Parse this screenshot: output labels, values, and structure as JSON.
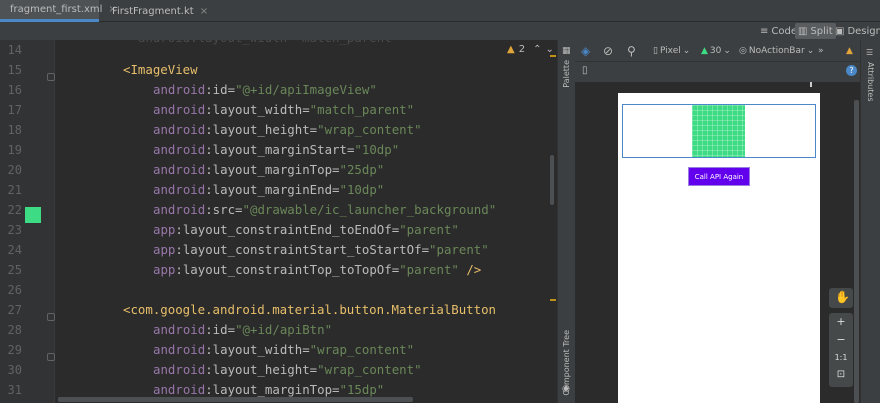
{
  "tabs": [
    {
      "label": "fragment_first.xml",
      "icon": "xml-file-icon",
      "active": true
    },
    {
      "label": "FirstFragment.kt",
      "icon": "kotlin-file-icon",
      "active": false
    }
  ],
  "view_modes": {
    "code": "Code",
    "split": "Split",
    "design": "Design"
  },
  "editor": {
    "warning_count": "2",
    "lines": [
      {
        "n": "14",
        "parts": []
      },
      {
        "n": "15",
        "parts": [
          {
            "c": "punc",
            "t": "<"
          },
          {
            "c": "tag",
            "t": "ImageView"
          }
        ]
      },
      {
        "n": "16",
        "parts": [
          {
            "c": "ns",
            "t": "android"
          },
          {
            "c": "attr",
            "t": ":id="
          },
          {
            "c": "val",
            "t": "\"@+id/apiImageView\""
          }
        ]
      },
      {
        "n": "17",
        "parts": [
          {
            "c": "ns",
            "t": "android"
          },
          {
            "c": "attr",
            "t": ":layout_width="
          },
          {
            "c": "val",
            "t": "\"match_parent\""
          }
        ]
      },
      {
        "n": "18",
        "parts": [
          {
            "c": "ns",
            "t": "android"
          },
          {
            "c": "attr",
            "t": ":layout_height="
          },
          {
            "c": "val",
            "t": "\"wrap_content\""
          }
        ]
      },
      {
        "n": "19",
        "parts": [
          {
            "c": "ns",
            "t": "android"
          },
          {
            "c": "attr",
            "t": ":layout_marginStart="
          },
          {
            "c": "val",
            "t": "\"10dp\""
          }
        ]
      },
      {
        "n": "20",
        "parts": [
          {
            "c": "ns",
            "t": "android"
          },
          {
            "c": "attr",
            "t": ":layout_marginTop="
          },
          {
            "c": "val",
            "t": "\"25dp\""
          }
        ]
      },
      {
        "n": "21",
        "parts": [
          {
            "c": "ns",
            "t": "android"
          },
          {
            "c": "attr",
            "t": ":layout_marginEnd="
          },
          {
            "c": "val",
            "t": "\"10dp\""
          }
        ]
      },
      {
        "n": "22",
        "parts": [
          {
            "c": "ns",
            "t": "android"
          },
          {
            "c": "attr",
            "t": ":src="
          },
          {
            "c": "val",
            "t": "\"@drawable/ic_launcher_background\""
          }
        ]
      },
      {
        "n": "23",
        "parts": [
          {
            "c": "ns",
            "t": "app"
          },
          {
            "c": "attr",
            "t": ":layout_constraintEnd_toEndOf="
          },
          {
            "c": "val",
            "t": "\"parent\""
          }
        ]
      },
      {
        "n": "24",
        "parts": [
          {
            "c": "ns",
            "t": "app"
          },
          {
            "c": "attr",
            "t": ":layout_constraintStart_toStartOf="
          },
          {
            "c": "val",
            "t": "\"parent\""
          }
        ]
      },
      {
        "n": "25",
        "parts": [
          {
            "c": "ns",
            "t": "app"
          },
          {
            "c": "attr",
            "t": ":layout_constraintTop_toTopOf="
          },
          {
            "c": "val",
            "t": "\"parent\""
          },
          {
            "c": "punc",
            "t": " />"
          }
        ]
      },
      {
        "n": "26",
        "parts": []
      },
      {
        "n": "27",
        "parts": [
          {
            "c": "punc",
            "t": "<"
          },
          {
            "c": "tag",
            "t": "com.google.android.material.button.MaterialButton"
          }
        ]
      },
      {
        "n": "28",
        "parts": [
          {
            "c": "ns",
            "t": "android"
          },
          {
            "c": "attr",
            "t": ":id="
          },
          {
            "c": "val",
            "t": "\"@+id/apiBtn\""
          }
        ]
      },
      {
        "n": "29",
        "parts": [
          {
            "c": "ns",
            "t": "android"
          },
          {
            "c": "attr",
            "t": ":layout_width="
          },
          {
            "c": "val",
            "t": "\"wrap_content\""
          }
        ]
      },
      {
        "n": "30",
        "parts": [
          {
            "c": "ns",
            "t": "android"
          },
          {
            "c": "attr",
            "t": ":layout_height="
          },
          {
            "c": "val",
            "t": "\"wrap_content\""
          }
        ]
      },
      {
        "n": "31",
        "parts": [
          {
            "c": "ns",
            "t": "android"
          },
          {
            "c": "attr",
            "t": ":layout_marginTop="
          },
          {
            "c": "val",
            "t": "\"15dp\""
          }
        ]
      }
    ]
  },
  "side_panels": {
    "palette": "Palette",
    "component_tree": "Component Tree",
    "attributes": "Attributes"
  },
  "design_toolbar": {
    "device": "Pixel",
    "api_level": "30",
    "theme": "NoActionBar",
    "more": "»"
  },
  "preview": {
    "button_label": "Call API Again"
  },
  "zoom": {
    "zoom_in": "+",
    "zoom_out": "−",
    "one_to_one": "1:1"
  },
  "colors": {
    "accent": "#4a88c7",
    "button": "#6200ee",
    "image": "#3ddc84",
    "tag": "#e8bf6a",
    "value": "#6a8759"
  }
}
